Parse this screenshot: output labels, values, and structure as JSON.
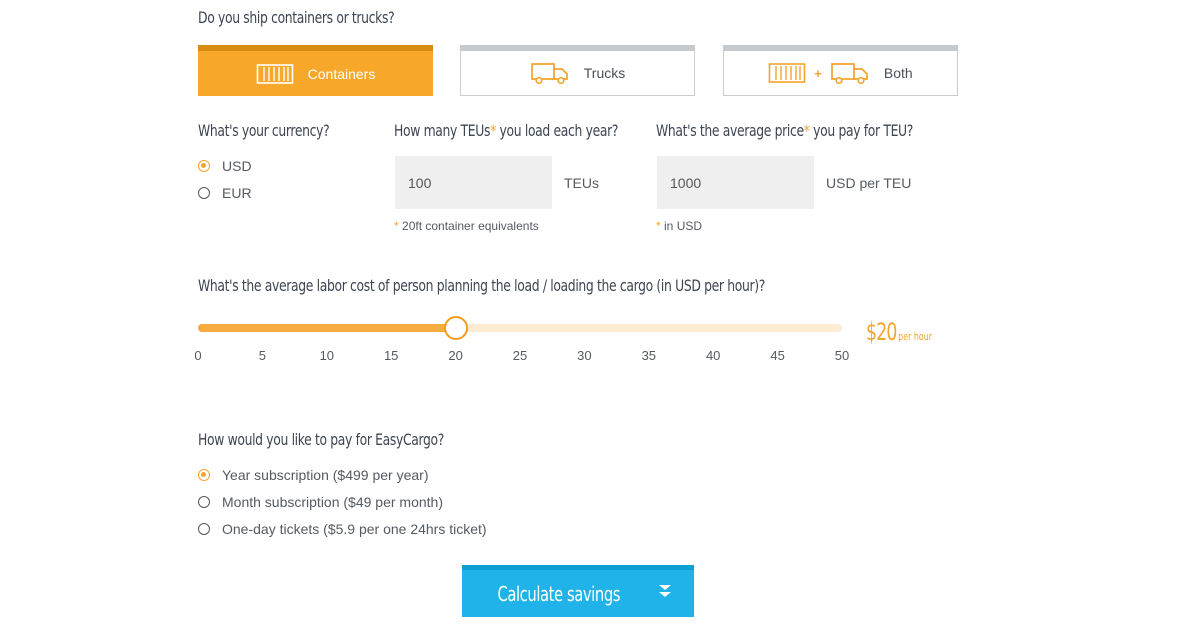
{
  "ship": {
    "question": "Do you ship containers or trucks?",
    "options": [
      {
        "label": "Containers",
        "icon": "container-icon",
        "selected": true
      },
      {
        "label": "Trucks",
        "icon": "truck-icon",
        "selected": false
      },
      {
        "label": "Both",
        "icon": "container-plus-truck-icon",
        "selected": false
      }
    ],
    "plus": "+"
  },
  "currency": {
    "question": "What's your currency?",
    "options": [
      {
        "label": "USD",
        "selected": true
      },
      {
        "label": "EUR",
        "selected": false
      }
    ]
  },
  "teus": {
    "question": "How many TEUs",
    "question_tail": " you load each year?",
    "asterisk": "*",
    "value": "100",
    "unit": "TEUs",
    "note": "20ft container equivalents"
  },
  "price": {
    "question": "What's the average price",
    "question_tail": " you pay for TEU?",
    "asterisk": "*",
    "value": "1000",
    "unit": "USD per TEU",
    "note": "in USD"
  },
  "labor": {
    "question": "What's the average labor cost of person planning the load / loading the cargo (in USD per hour)?",
    "value": 20,
    "min": 0,
    "max": 50,
    "ticks": [
      "0",
      "5",
      "10",
      "15",
      "20",
      "25",
      "30",
      "35",
      "40",
      "45",
      "50"
    ],
    "value_label": "$20",
    "value_suffix": "per hour"
  },
  "payment": {
    "question": "How would you like to pay for EasyCargo?",
    "options": [
      {
        "label": "Year subscription ($499 per year)",
        "selected": true
      },
      {
        "label": "Month subscription ($49 per month)",
        "selected": false
      },
      {
        "label": "One-day tickets ($5.9 per one 24hrs ticket)",
        "selected": false
      }
    ]
  },
  "calculate": {
    "label": "Calculate savings",
    "icon": "double-chevron-down-icon"
  },
  "colors": {
    "accent": "#f7a82b",
    "button": "#1fb3e9",
    "slider_track": "#fdebd3"
  }
}
